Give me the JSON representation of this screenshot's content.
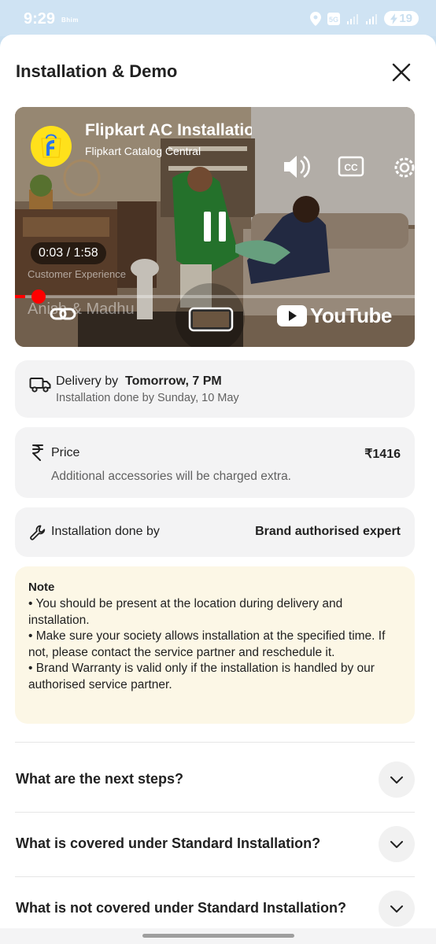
{
  "status_bar": {
    "time": "9:29",
    "carrier": "Bhim",
    "battery": "19"
  },
  "sheet": {
    "title": "Installation & Demo"
  },
  "video": {
    "title": "Flipkart AC Installation",
    "channel": "Flipkart Catalog Central",
    "current_time": "0:03",
    "separator": "/",
    "duration": "1:58",
    "progress_fraction": 0.025,
    "overlay_text_1": "Customer Experience",
    "overlay_text_2": "Anish & Madhu",
    "youtube_label": "YouTube"
  },
  "delivery": {
    "prefix": "Delivery by",
    "when": "Tomorrow, 7 PM",
    "installation": "Installation done by Sunday, 10 May"
  },
  "price": {
    "label": "Price",
    "value": "₹1416",
    "note": "Additional accessories will be charged extra."
  },
  "installer": {
    "label": "Installation done by",
    "value": "Brand authorised expert"
  },
  "note": {
    "title": "Note",
    "lines": [
      "• You should be present at the location during delivery and installation.",
      "• Make sure your society allows installation at the specified time. If not, please contact the service partner and reschedule it.",
      "• Brand Warranty is valid only if the installation is handled by our authorised service partner."
    ]
  },
  "faqs": [
    {
      "question": "What are the next steps?"
    },
    {
      "question": "What is covered under Standard Installation?"
    },
    {
      "question": "What is not covered under Standard Installation?"
    }
  ],
  "colors": {
    "youtube_red": "#ff0000",
    "flipkart_yellow": "#ffe11b",
    "flipkart_blue": "#2874f0",
    "note_bg": "#fcf7e6",
    "card_bg": "#f3f3f4"
  }
}
